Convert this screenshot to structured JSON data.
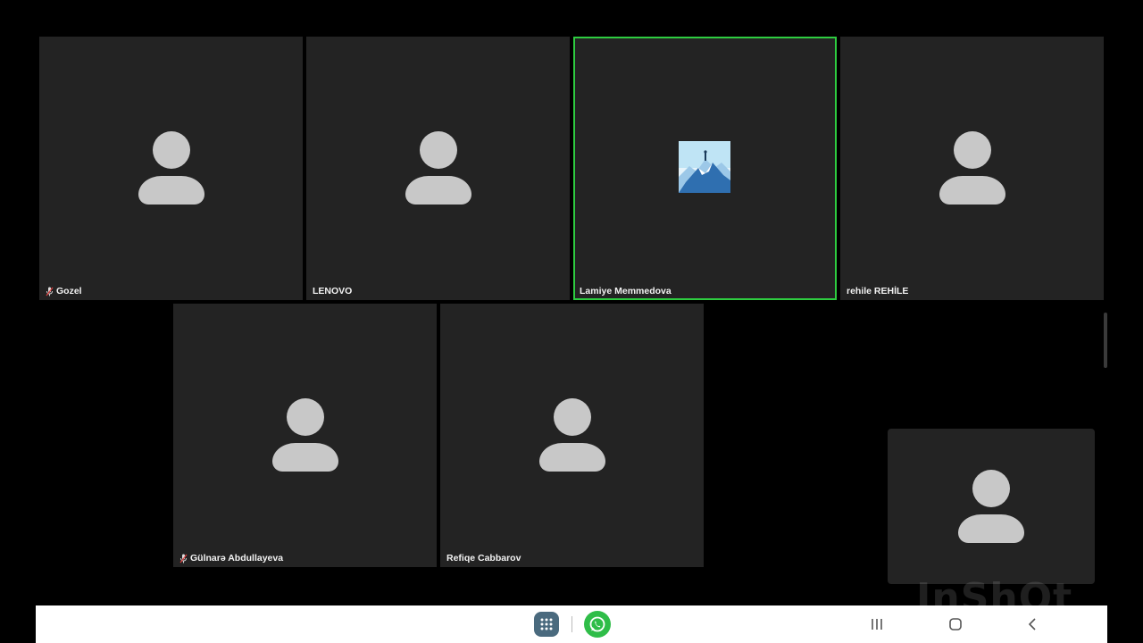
{
  "participants": [
    {
      "name": "Gozel",
      "muted": true
    },
    {
      "name": "LENOVO",
      "muted": false
    },
    {
      "name": "Lamiye Memmedova",
      "muted": false,
      "active_speaker": true,
      "has_picture": true
    },
    {
      "name": "rehile REHİLE",
      "muted": false
    },
    {
      "name": "Gülnarə Abdullayeva",
      "muted": true
    },
    {
      "name": "Refiqe Cabbarov",
      "muted": false
    }
  ],
  "self_view": {
    "icon": "person-icon"
  },
  "watermark": {
    "text": "InShOt"
  },
  "navbar": {
    "apps_icon": "apps-grid-icon",
    "whatsapp_icon": "whatsapp-icon",
    "recent_icon": "recent-apps-icon",
    "home_icon": "home-icon",
    "back_icon": "back-icon"
  },
  "colors": {
    "background": "#000000",
    "tile": "#232323",
    "active_border": "#2ecc40",
    "avatar": "#c8c8c8",
    "navbar": "#ffffff"
  }
}
